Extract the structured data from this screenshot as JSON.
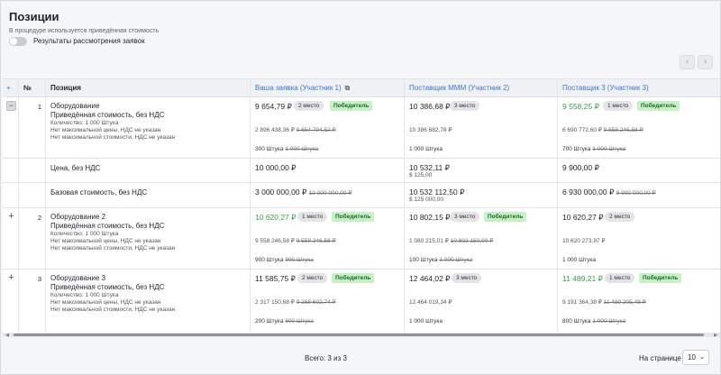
{
  "header": {
    "title": "Позиции",
    "note": "В процедуре используется приведённая стоимость",
    "toggle_label": "Результаты рассмотрения заявок"
  },
  "nav": {
    "prev": "‹",
    "next": "›"
  },
  "table": {
    "columns": {
      "expand": "+",
      "num": "№",
      "position": "Позиция",
      "p1": "Ваша заявка (Участник 1)",
      "p2": "Поставщик МММ (Участник 2)",
      "p3": "Поставщик 3 (Участник 3)"
    },
    "rows": [
      {
        "expand": "−",
        "num": "1",
        "name": "Оборудование",
        "sub1": "Приведённая стоимость, без НДС",
        "sub2": "Количество: 1 000 Штука",
        "sub3": "Нет максимальной цены, НДС не указан",
        "sub4": "Нет максимальной стоимости, НДС не указан",
        "offers": [
          {
            "price": "9 654,79 ₽",
            "place": "2 место",
            "winner": "Победитель",
            "total": "2 896 438,36 ₽",
            "total_old": "9 654 794,52 ₽",
            "qty": "300 Штука",
            "qty_old": "1 000 Штука"
          },
          {
            "price": "10 386,68 ₽",
            "place": "3 место",
            "winner": "",
            "total": "10 386 682,78 ₽",
            "total_old": "",
            "qty": "1 000 Штука",
            "qty_old": ""
          },
          {
            "price": "9 558,25 ₽",
            "place": "1 место",
            "winner": "Победитель",
            "total": "6 690 772,60 ₽",
            "total_old": "9 558 246,58 ₽",
            "qty": "700 Штука",
            "qty_old": "1 000 Штука"
          }
        ]
      },
      {
        "name": "Цена, без НДС",
        "offers": [
          {
            "price": "10 000,00 ₽",
            "sub": ""
          },
          {
            "price": "10 532,11 ₽",
            "sub": "$ 125,00"
          },
          {
            "price": "9 900,00 ₽",
            "sub": ""
          }
        ]
      },
      {
        "name": "Базовая стоимость, без НДС",
        "offers": [
          {
            "price": "3 000 000,00 ₽",
            "price_old": "10 000 000,00 ₽",
            "sub": ""
          },
          {
            "price": "10 532 112,50 ₽",
            "price_old": "",
            "sub": "$ 125 000,00"
          },
          {
            "price": "6 930 000,00 ₽",
            "price_old": "9 900 000,00 ₽",
            "sub": ""
          }
        ]
      },
      {
        "expand": "+",
        "num": "2",
        "name": "Оборудование 2",
        "sub1": "Приведённая стоимость, без НДС",
        "sub2": "Количество: 1 000 Штука",
        "sub3": "Нет максимальной цены, НДС не указан",
        "sub4": "Нет максимальной стоимости, НДС не указан",
        "offers": [
          {
            "price": "10 620,27 ₽",
            "place": "1 место",
            "winner": "Победитель",
            "total": "9 558 246,58 ₽",
            "total_old": "9 558 246,58 ₽",
            "qty": "900 Штука",
            "qty_old": "900 Штука"
          },
          {
            "price": "10 802,15 ₽",
            "place": "3 место",
            "winner": "Победитель",
            "total": "1 080 215,01 ₽",
            "total_old": "10 802 150,00 ₽",
            "qty": "100 Штука",
            "qty_old": "1 000 Штука"
          },
          {
            "price": "10 620,27 ₽",
            "place": "2 место",
            "winner": "",
            "total": "10 620 273,97 ₽",
            "total_old": "",
            "qty": "1 000 Штука",
            "qty_old": ""
          }
        ]
      },
      {
        "expand": "+",
        "num": "3",
        "name": "Оборудование 3",
        "sub1": "Приведённая стоимость, без НДС",
        "sub2": "Количество: 1 000 Штука",
        "sub3": "Нет максимальной цены, НДС не указан",
        "sub4": "Нет максимальной стоимости, НДС не указан",
        "offers": [
          {
            "price": "11 585,75 ₽",
            "place": "2 место",
            "winner": "Победитель",
            "total": "2 317 150,68 ₽",
            "total_old": "9 268 602,74 ₽",
            "qty": "200 Штука",
            "qty_old": "800 Штука"
          },
          {
            "price": "12 464,02 ₽",
            "place": "3 место",
            "winner": "",
            "total": "12 464 019,34 ₽",
            "total_old": "",
            "qty": "1 000 Штука",
            "qty_old": ""
          },
          {
            "price": "11 489,21 ₽",
            "place": "1 место",
            "winner": "Победитель",
            "total": "9 191 364,38 ₽",
            "total_old": "11 489 205,48 ₽",
            "qty": "800 Штука",
            "qty_old": "1 000 Штука"
          }
        ]
      }
    ]
  },
  "footer": {
    "total": "Всего: 3 из 3",
    "per_page_label": "На странице",
    "per_page_value": "10"
  },
  "colors": {
    "link": "#3a78c3",
    "winner_bg": "#c9efc9",
    "green_price": "#3aa04a"
  }
}
